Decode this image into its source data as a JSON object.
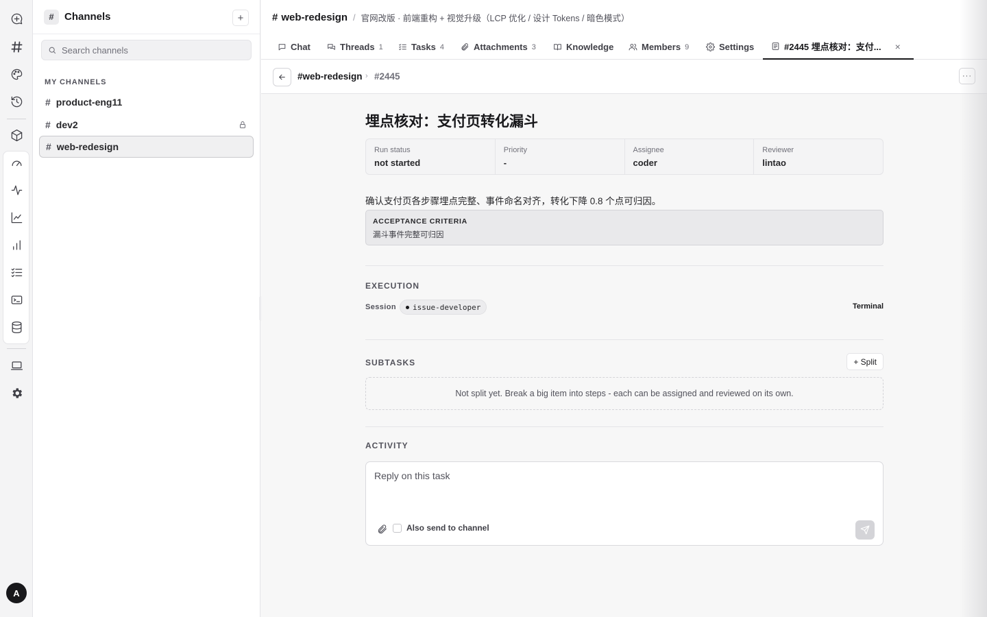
{
  "rail": {
    "icons": [
      "new-chat-icon",
      "channels-icon",
      "palette-icon",
      "history-icon",
      "package-icon",
      "dashboard-icon",
      "activity-icon",
      "trend-icon",
      "bar-chart-icon",
      "checklist-icon",
      "terminal-icon",
      "database-icon",
      "laptop-icon",
      "settings-icon"
    ],
    "avatar": "A"
  },
  "sidebar": {
    "title": "Channels",
    "add_label": "+",
    "search_placeholder": "Search channels",
    "section_label": "MY CHANNELS",
    "items": [
      {
        "label": "product-eng11",
        "locked": false
      },
      {
        "label": "dev2",
        "locked": true
      },
      {
        "label": "web-redesign",
        "locked": false,
        "active": true
      }
    ]
  },
  "topbar": {
    "hash": "#",
    "channel": "web-redesign",
    "separator": "/",
    "description": "官网改版 · 前端重构 + 视觉升级（LCP 优化 / 设计 Tokens / 暗色模式）"
  },
  "tabs": [
    {
      "label": "Chat",
      "count": "",
      "icon": "chat-icon"
    },
    {
      "label": "Threads",
      "count": "1",
      "icon": "threads-icon"
    },
    {
      "label": "Tasks",
      "count": "4",
      "icon": "tasks-icon"
    },
    {
      "label": "Attachments",
      "count": "3",
      "icon": "paperclip-icon"
    },
    {
      "label": "Knowledge",
      "count": "",
      "icon": "book-icon"
    },
    {
      "label": "Members",
      "count": "9",
      "icon": "users-icon"
    },
    {
      "label": "Settings",
      "count": "",
      "icon": "gear-icon"
    },
    {
      "label": "#2445 埋点核对：支付...",
      "count": "",
      "icon": "document-icon",
      "active": true,
      "close": "×"
    }
  ],
  "breadcrumb": {
    "channel": "#web-redesign",
    "separator": "›",
    "task_id": "#2445",
    "more": "···"
  },
  "task": {
    "title": "埋点核对：支付页转化漏斗",
    "meta": [
      {
        "label": "Run status",
        "value": "not started"
      },
      {
        "label": "Priority",
        "value": "-"
      },
      {
        "label": "Assignee",
        "value": "coder"
      },
      {
        "label": "Reviewer",
        "value": "lintao"
      }
    ],
    "description": "确认支付页各步骤埋点完整、事件命名对齐，转化下降 0.8 个点可归因。",
    "acceptance_label": "ACCEPTANCE CRITERIA",
    "acceptance_text": "漏斗事件完整可归因"
  },
  "execution": {
    "heading": "EXECUTION",
    "session_label": "Session",
    "session_value": "issue-developer",
    "terminal_label": "Terminal"
  },
  "subtasks": {
    "heading": "SUBTASKS",
    "split_label": "+ Split",
    "empty_text": "Not split yet. Break a big item into steps - each can be assigned and reviewed on its own."
  },
  "activity": {
    "heading": "ACTIVITY",
    "reply_placeholder": "Reply on this task",
    "also_send_label": "Also send to channel",
    "also_send_checked": false
  }
}
